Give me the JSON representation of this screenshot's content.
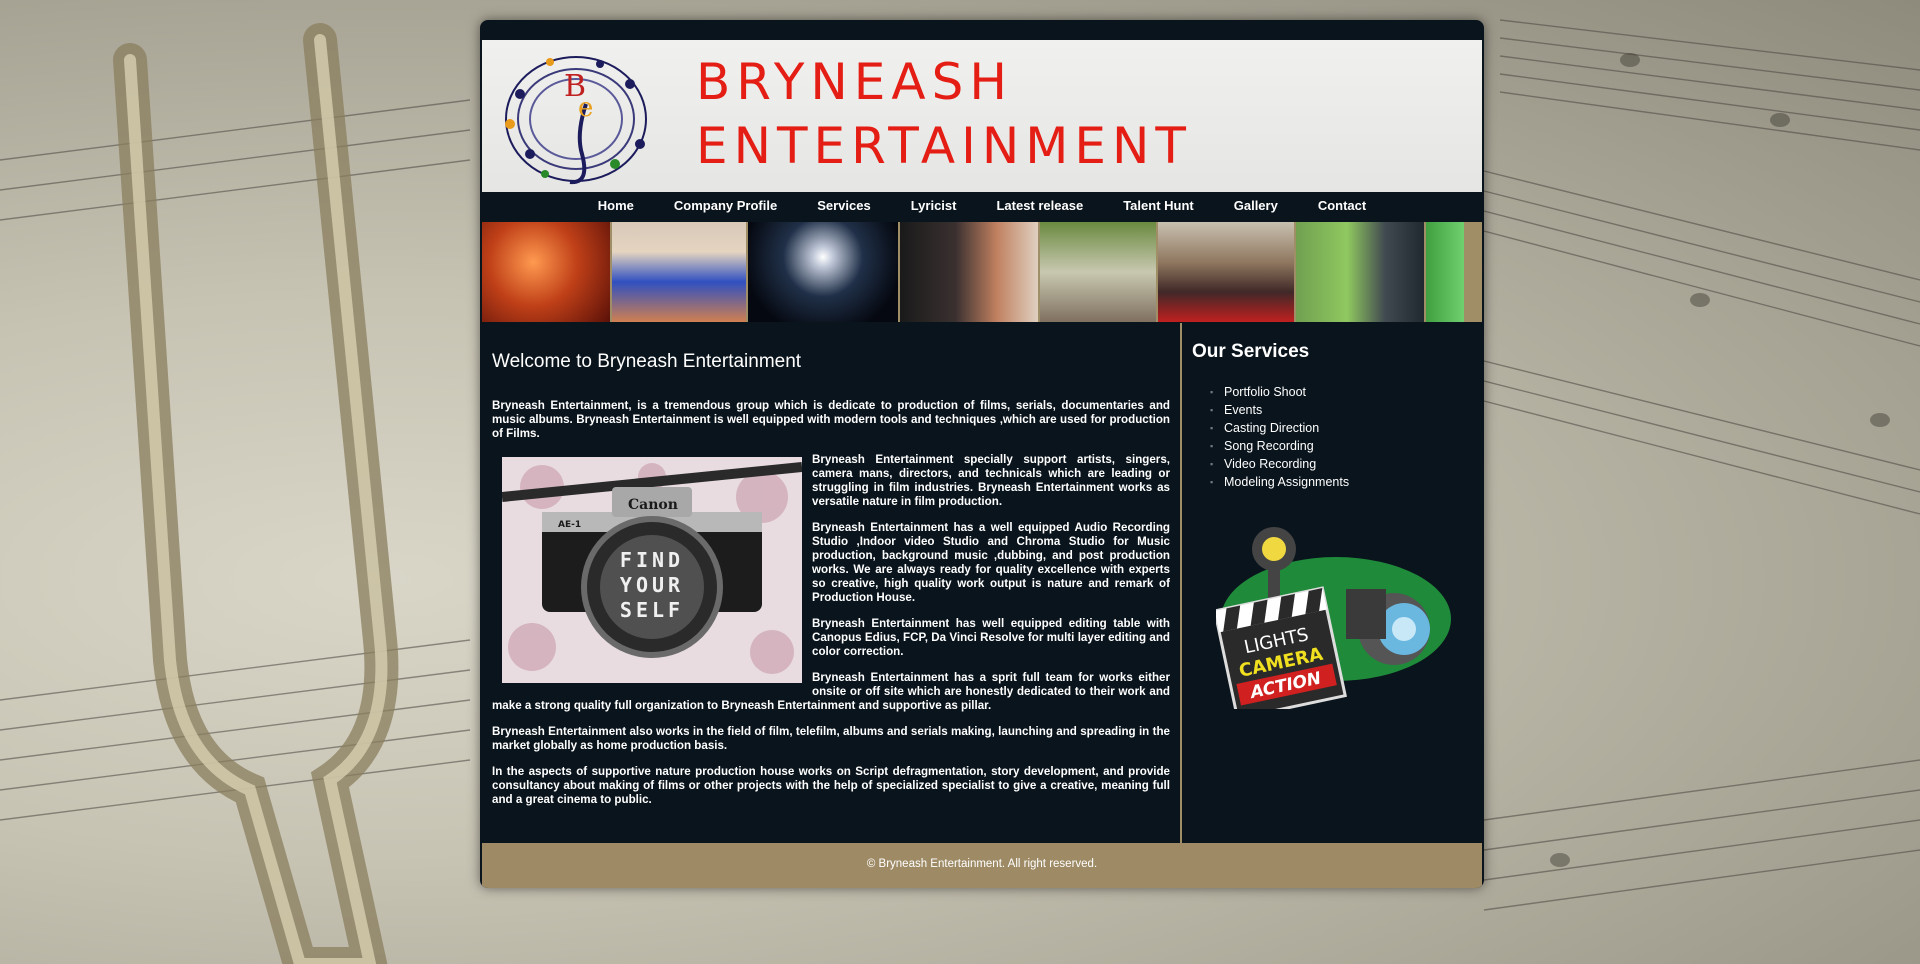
{
  "brand": {
    "logo_letters": "Be",
    "line1": "BRYNEASH",
    "line2": "ENTERTAINMENT"
  },
  "nav": [
    "Home",
    "Company Profile",
    "Services",
    "Lyricist",
    "Latest release",
    "Talent Hunt",
    "Gallery",
    "Contact"
  ],
  "main": {
    "heading": "Welcome to Bryneash Entertainment",
    "camera_text": [
      "FIND",
      "YOUR",
      "SELF"
    ],
    "camera_brand": "Canon",
    "camera_model": "AE-1",
    "paragraphs": [
      "Bryneash Entertainment, is a tremendous group which is dedicate to production of films, serials, documentaries and music albums. Bryneash Entertainment is well equipped with modern tools and techniques ,which are used for production of Films.",
      "Bryneash Entertainment specially support artists, singers, camera mans, directors, and technicals which are leading or struggling in film industries. Bryneash Entertainment works as versatile nature in film production.",
      "Bryneash Entertainment has a well equipped Audio Recording Studio ,Indoor video Studio and Chroma Studio for Music production, background music ,dubbing, and post production works. We are always ready for quality excellence with experts so creative, high quality work output is nature and remark of Production House.",
      "Bryneash Entertainment has well equipped editing table with Canopus Edius, FCP, Da Vinci Resolve for multi layer editing and color correction.",
      "Bryneash Entertainment has a sprit full team for works either onsite or off site which are honestly dedicated to their work and make a strong quality full organization to Bryneash Entertainment and supportive as pillar.",
      "Bryneash Entertainment also works in the field of film, telefilm, albums and serials making, launching and spreading in the market globally as home production basis.",
      "In the aspects of supportive nature production house works on Script defragmentation, story development, and provide consultancy about making of films or other projects with the help of specialized specialist to give a creative, meaning full and a great cinema to public."
    ]
  },
  "sidebar": {
    "title": "Our Services",
    "services": [
      "Portfolio Shoot",
      "Events",
      "Casting Direction",
      "Song Recording",
      "Video Recording",
      "Modeling Assignments"
    ],
    "lca_lines": [
      "LIGHTS",
      "CAMERA",
      "ACTION"
    ]
  },
  "footer": "© Bryneash Entertainment. All right reserved.",
  "colors": {
    "brand_red": "#e41e14",
    "panel": "#0a141c",
    "accent_tan": "#9e8b65"
  }
}
